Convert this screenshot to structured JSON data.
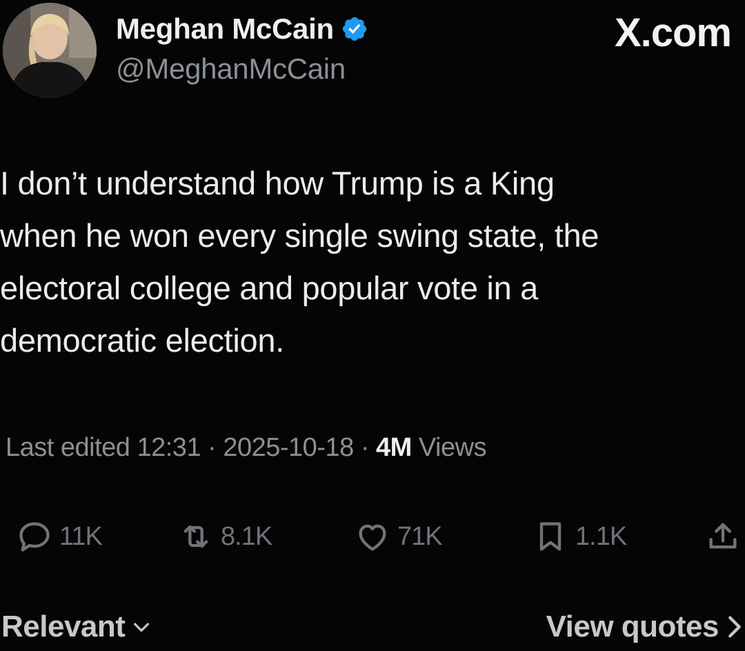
{
  "author": {
    "display_name": "Meghan McCain",
    "handle": "@MeghanMcCain",
    "verified": true
  },
  "brand": {
    "label": "X.com"
  },
  "tweet": {
    "text": "I don’t understand how Trump is a King\nwhen he won every single swing state, the\nelectoral college and popular vote in a\ndemocratic election."
  },
  "meta": {
    "edited_prefix": "Last edited",
    "time": "12:31",
    "date": "2025-10-18",
    "views_count": "4M",
    "views_label": "Views"
  },
  "actions": {
    "replies": "11K",
    "reposts": "8.1K",
    "likes": "71K",
    "bookmarks": "1.1K"
  },
  "footer": {
    "sort_label": "Relevant",
    "view_quotes_label": "View quotes"
  },
  "colors": {
    "background": "#050505",
    "verified_blue": "#1d9bf0",
    "muted_text": "#8b9096"
  }
}
